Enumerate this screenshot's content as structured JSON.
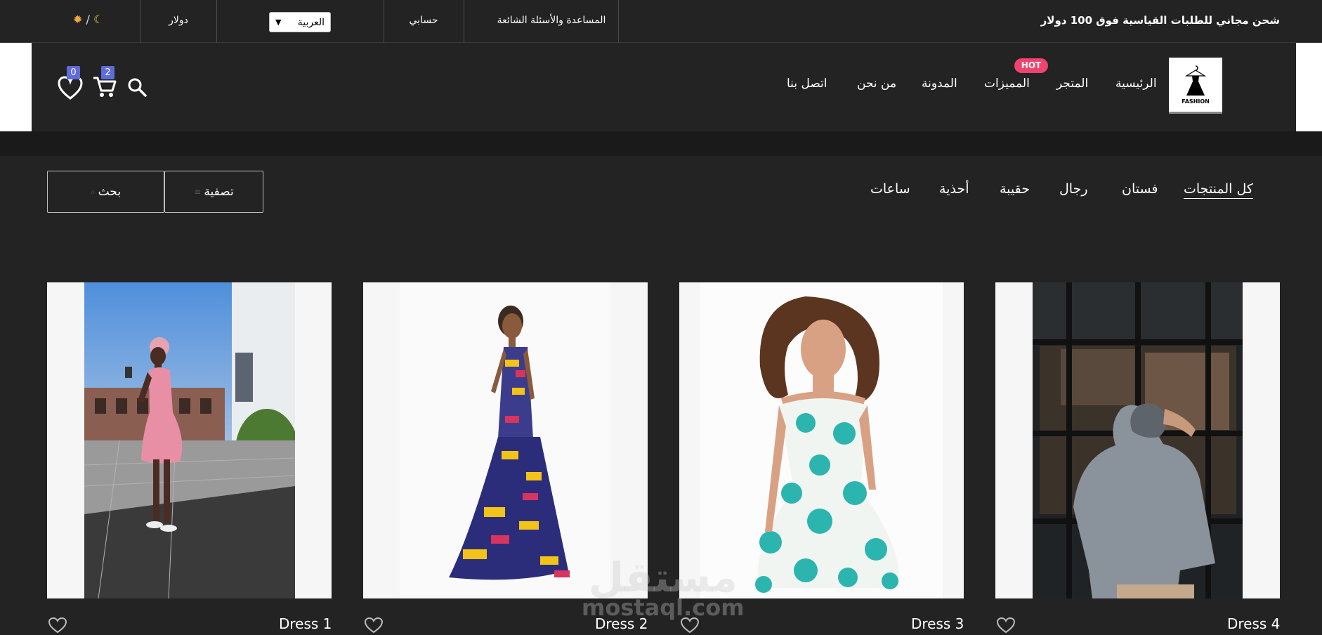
{
  "topbar": {
    "shipping_text": "شحن مجاني للطلبات القياسية فوق 100 دولار",
    "help_link": "المساعدة والأسئلة الشائعة",
    "account_link": "حسابي",
    "language_selected": "العربية",
    "currency_selected": "دولار",
    "theme_toggle_separator": "/"
  },
  "nav": {
    "logo_text": "FASHION",
    "items": [
      {
        "label": "الرئيسية"
      },
      {
        "label": "المتجر"
      },
      {
        "label": "المميزات"
      },
      {
        "label": "المدونة"
      },
      {
        "label": "من نحن"
      },
      {
        "label": "اتصل بنا"
      }
    ],
    "hot_badge": "HOT",
    "cart_count": "2",
    "wishlist_count": "0"
  },
  "filters": {
    "categories": [
      {
        "label": "كل المنتجات",
        "active": true
      },
      {
        "label": "فستان"
      },
      {
        "label": "رجال"
      },
      {
        "label": "حقيبة"
      },
      {
        "label": "أحذية"
      },
      {
        "label": "ساعات"
      }
    ],
    "filter_button": "تصفية",
    "search_button": "بحث"
  },
  "products": [
    {
      "name": "Dress 4",
      "image": "man-grey-hoodie"
    },
    {
      "name": "Dress 3",
      "image": "woman-teal-floral-dress"
    },
    {
      "name": "Dress 2",
      "image": "woman-patterned-gown"
    },
    {
      "name": "Dress 1",
      "image": "woman-pink-dress-street"
    }
  ],
  "watermark": {
    "arabic": "مستقل",
    "latin": "mostaql.com"
  },
  "colors": {
    "background": "#232323",
    "hot_badge": "#f0436f",
    "count_badge": "#5f6bd6"
  }
}
